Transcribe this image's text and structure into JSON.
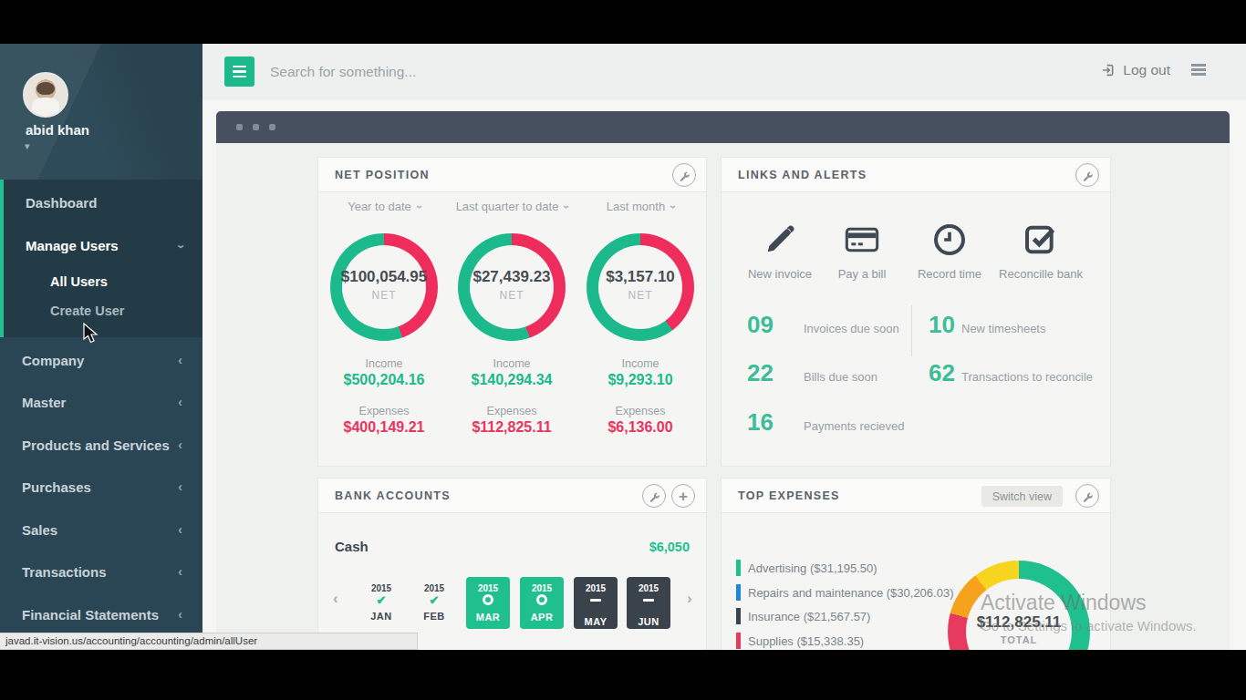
{
  "topbar": {
    "search_placeholder": "Search for something...",
    "logout_label": "Log out"
  },
  "sidebar": {
    "user": {
      "name": "abid khan"
    },
    "menu": [
      {
        "label": "Dashboard"
      },
      {
        "label": "Manage Users",
        "expanded": true
      },
      {
        "label": "All Users",
        "child": true,
        "hovered": true
      },
      {
        "label": "Create User",
        "child": true
      },
      {
        "label": "Company",
        "collapsed": true
      },
      {
        "label": "Master",
        "collapsed": true
      },
      {
        "label": "Products and Services",
        "collapsed": true
      },
      {
        "label": "Purchases",
        "collapsed": true
      },
      {
        "label": "Sales",
        "collapsed": true
      },
      {
        "label": "Transactions",
        "collapsed": true
      },
      {
        "label": "Financial Statements",
        "collapsed": true
      }
    ],
    "chevron_left": "‹",
    "chevron_down": "‹",
    "user_caret": "▾"
  },
  "panels": {
    "net_position": {
      "title": "NET POSITION",
      "periods": [
        {
          "label": "Year to date",
          "net": "$100,054.95",
          "net_caption": "NET",
          "income_label": "Income",
          "income": "$500,204.16",
          "expenses_label": "Expenses",
          "expenses": "$400,149.21"
        },
        {
          "label": "Last quarter to date",
          "net": "$27,439.23",
          "net_caption": "NET",
          "income_label": "Income",
          "income": "$140,294.34",
          "expenses_label": "Expenses",
          "expenses": "$112,825.11"
        },
        {
          "label": "Last month",
          "net": "$3,157.10",
          "net_caption": "NET",
          "income_label": "Income",
          "income": "$9,293.10",
          "expenses_label": "Expenses",
          "expenses": "$6,136.00"
        }
      ]
    },
    "links_alerts": {
      "title": "LINKS AND ALERTS",
      "links": [
        {
          "label": "New invoice",
          "icon": "pencil-icon"
        },
        {
          "label": "Pay a bill",
          "icon": "credit-card-icon"
        },
        {
          "label": "Record time",
          "icon": "clock-icon"
        },
        {
          "label": "Reconcille bank",
          "icon": "checkbox-icon"
        }
      ],
      "alerts": [
        {
          "count": "09",
          "label": "Invoices due soon"
        },
        {
          "count": "10",
          "label": "New timesheets"
        },
        {
          "count": "22",
          "label": "Bills due soon"
        },
        {
          "count": "62",
          "label": "Transactions to reconcile"
        },
        {
          "count": "16",
          "label": "Payments recieved"
        }
      ]
    },
    "bank_accounts": {
      "title": "BANK ACCOUNTS",
      "account_name": "Cash",
      "balance": "$6,050",
      "months": [
        {
          "year": "2015",
          "month": "JAN",
          "status": "reconciled"
        },
        {
          "year": "2015",
          "month": "FEB",
          "status": "reconciled"
        },
        {
          "year": "2015",
          "month": "MAR",
          "status": "open"
        },
        {
          "year": "2015",
          "month": "APR",
          "status": "open"
        },
        {
          "year": "2015",
          "month": "MAY",
          "status": "pending"
        },
        {
          "year": "2015",
          "month": "JUN",
          "status": "pending"
        }
      ],
      "prev_arrow": "‹",
      "next_arrow": "›"
    },
    "top_expenses": {
      "title": "TOP EXPENSES",
      "switch_label": "Switch view",
      "legend": [
        {
          "label": "Advertising ($31,195.50)",
          "color": "#1fc08e"
        },
        {
          "label": "Repairs and maintenance ($30,206.03)",
          "color": "#1d87d8"
        },
        {
          "label": "Insurance ($21,567.57)",
          "color": "#3c434c"
        },
        {
          "label": "Supplies ($15,338.35)",
          "color": "#e83a5f"
        }
      ],
      "total_value": "$112,825.11",
      "total_caption": "TOTAL"
    }
  },
  "watermark": {
    "line1": "Activate Windows",
    "line2": "Go to Settings to activate Windows."
  },
  "status_url": "javad.it-vision.us/accounting/accounting/admin/allUser",
  "colors": {
    "accent_green": "#1bb98c",
    "accent_red": "#ee2d5d",
    "sidebar_bg": "#2a4553",
    "winbar_bg": "#47505e"
  },
  "chart_data": [
    {
      "type": "pie",
      "title": "NET POSITION",
      "groups": [
        "Year to date",
        "Last quarter to date",
        "Last month"
      ],
      "series": [
        {
          "name": "Income",
          "values": [
            500204.16,
            140294.34,
            9293.1
          ],
          "color": "#1bb98c"
        },
        {
          "name": "Expenses",
          "values": [
            400149.21,
            112825.11,
            6136.0
          ],
          "color": "#ee2d5d"
        }
      ],
      "net": [
        100054.95,
        27439.23,
        3157.1
      ],
      "legend_position": "none"
    },
    {
      "type": "pie",
      "title": "TOP EXPENSES",
      "categories": [
        "Advertising",
        "Repairs and maintenance",
        "Insurance",
        "Supplies"
      ],
      "values": [
        31195.5,
        30206.03,
        21567.57,
        15338.35
      ],
      "total": 112825.11,
      "colors": [
        "#1fc08e",
        "#1d87d8",
        "#3c434c",
        "#e83a5f"
      ],
      "visual_segments": [
        {
          "color": "#1fc08e",
          "deg": 140
        },
        {
          "color": "#1d87d8",
          "deg": 35
        },
        {
          "color": "#3c434c",
          "deg": 40
        },
        {
          "color": "#e83a5f",
          "deg": 70
        },
        {
          "color": "#f6a21d",
          "deg": 37
        },
        {
          "color": "#f7d51f",
          "deg": 38
        }
      ],
      "legend_position": "left"
    }
  ]
}
